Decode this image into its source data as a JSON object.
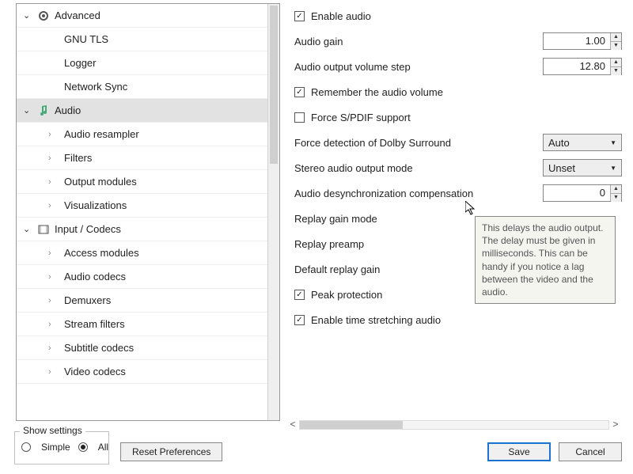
{
  "sidebar": {
    "items": [
      {
        "label": "Advanced",
        "arrow": "down",
        "icon": "gear"
      },
      {
        "label": "GNU TLS",
        "indent": 2
      },
      {
        "label": "Logger",
        "indent": 2
      },
      {
        "label": "Network Sync",
        "indent": 2
      },
      {
        "label": "Audio",
        "arrow": "down",
        "icon": "note",
        "selected": true
      },
      {
        "label": "Audio resampler",
        "indent": 2,
        "chevron": true
      },
      {
        "label": "Filters",
        "indent": 2,
        "chevron": true
      },
      {
        "label": "Output modules",
        "indent": 2,
        "chevron": true
      },
      {
        "label": "Visualizations",
        "indent": 2,
        "chevron": true
      },
      {
        "label": "Input / Codecs",
        "arrow": "down",
        "icon": "film"
      },
      {
        "label": "Access modules",
        "indent": 2,
        "chevron": true
      },
      {
        "label": "Audio codecs",
        "indent": 2,
        "chevron": true
      },
      {
        "label": "Demuxers",
        "indent": 2,
        "chevron": true
      },
      {
        "label": "Stream filters",
        "indent": 2,
        "chevron": true
      },
      {
        "label": "Subtitle codecs",
        "indent": 2,
        "chevron": true
      },
      {
        "label": "Video codecs",
        "indent": 2,
        "chevron": true
      }
    ]
  },
  "settings": {
    "enable_audio": {
      "label": "Enable audio",
      "checked": true
    },
    "audio_gain": {
      "label": "Audio gain",
      "value": "1.00"
    },
    "volume_step": {
      "label": "Audio output volume step",
      "value": "12.80"
    },
    "remember_volume": {
      "label": "Remember the audio volume",
      "checked": true
    },
    "force_spdif": {
      "label": "Force S/PDIF support",
      "checked": false
    },
    "dolby": {
      "label": "Force detection of Dolby Surround",
      "value": "Auto"
    },
    "stereo_mode": {
      "label": "Stereo audio output mode",
      "value": "Unset"
    },
    "desync": {
      "label": "Audio desynchronization compensation",
      "value": "0"
    },
    "replay_mode": {
      "label": "Replay gain mode"
    },
    "replay_preamp": {
      "label": "Replay preamp"
    },
    "default_replay": {
      "label": "Default replay gain"
    },
    "peak_protection": {
      "label": "Peak protection",
      "checked": true
    },
    "time_stretch": {
      "label": "Enable time stretching audio",
      "checked": true
    }
  },
  "tooltip": "This delays the audio output. The delay must be given in milliseconds. This can be handy if you notice a lag between the video and the audio.",
  "footer": {
    "fieldset_label": "Show settings",
    "radio_simple": "Simple",
    "radio_all": "All",
    "reset": "Reset Preferences",
    "save": "Save",
    "cancel": "Cancel"
  }
}
